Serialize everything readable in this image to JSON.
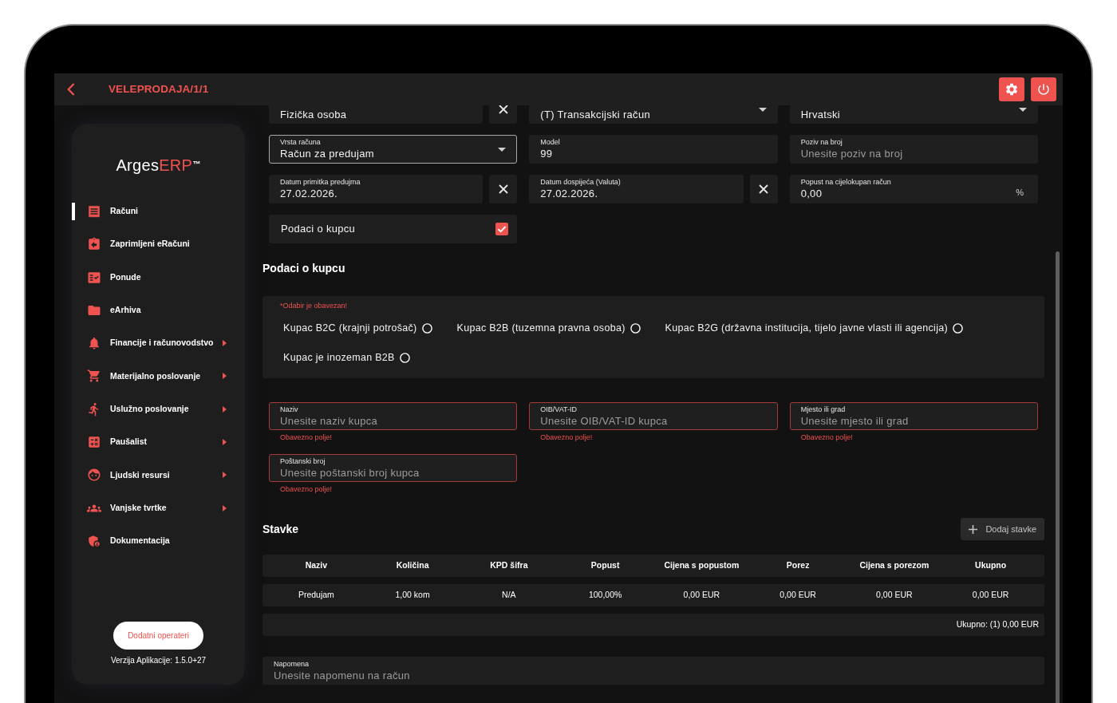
{
  "header": {
    "title": "VELEPRODAJA/1/1"
  },
  "sidebar": {
    "logo": {
      "name": "Arges",
      "accent": "ERP",
      "trademark": "™"
    },
    "items": [
      {
        "label": "Računi",
        "selected": true,
        "submenu": false
      },
      {
        "label": "Zaprimljeni eRačuni",
        "selected": false,
        "submenu": false
      },
      {
        "label": "Ponude",
        "selected": false,
        "submenu": false
      },
      {
        "label": "eArhiva",
        "selected": false,
        "submenu": false
      },
      {
        "label": "Financije i računovodstvo",
        "selected": false,
        "submenu": true
      },
      {
        "label": "Materijalno poslovanje",
        "selected": false,
        "submenu": true
      },
      {
        "label": "Uslužno poslovanje",
        "selected": false,
        "submenu": true
      },
      {
        "label": "Paušalist",
        "selected": false,
        "submenu": true
      },
      {
        "label": "Ljudski resursi",
        "selected": false,
        "submenu": true
      },
      {
        "label": "Vanjske tvrtke",
        "selected": false,
        "submenu": true
      },
      {
        "label": "Dokumentacija",
        "selected": false,
        "submenu": false
      }
    ],
    "button": "Dodatni operateri",
    "version": "Verzija Aplikacije: 1.5.0+27"
  },
  "invoice_form": {
    "fields": [
      {
        "kind": "text",
        "value": "Fizička osoba",
        "focused": false,
        "clearable": true
      },
      {
        "kind": "select",
        "value": "(T) Transakcijski račun",
        "focused": false,
        "clearable": false
      },
      {
        "kind": "select",
        "value": "Hrvatski",
        "focused": false,
        "clearable": false
      },
      {
        "kind": "select",
        "label": "Vrsta računa",
        "value": "Račun za predujam",
        "focused": true,
        "clearable": false
      },
      {
        "kind": "text",
        "label": "Model",
        "value": "99",
        "focused": false,
        "clearable": false
      },
      {
        "kind": "text",
        "label": "Poziv na broj",
        "placeholder": "Unesite poziv na broj",
        "focused": false,
        "clearable": false
      },
      {
        "kind": "text",
        "label": "Datum primitka predujma",
        "value": "27.02.2026.",
        "focused": false,
        "clearable": true
      },
      {
        "kind": "text",
        "label": "Datum dospijeća (Valuta)",
        "value": "27.02.2026.",
        "focused": false,
        "clearable": true
      },
      {
        "kind": "text",
        "label": "Popust na cijelokupan račun",
        "value": "0,00",
        "suffix": "%",
        "focused": false,
        "clearable": false
      },
      {
        "kind": "checkbox",
        "label": "Podaci o kupcu",
        "checked": true,
        "focused": false,
        "clearable": false
      }
    ]
  },
  "customer": {
    "title": "Podaci o kupcu",
    "type_choice": {
      "error": "*Odabir je obavezan!",
      "options": [
        {
          "label": "Kupac B2C (krajnji potrošač)",
          "selected": false
        },
        {
          "label": "Kupac B2B (tuzemna pravna osoba)",
          "selected": false
        },
        {
          "label": "Kupac B2G (državna institucija, tijelo javne vlasti ili agencija)",
          "selected": false
        },
        {
          "label": "Kupac je inozeman B2B",
          "selected": false
        }
      ]
    },
    "fields": [
      {
        "label": "Naziv",
        "placeholder": "Unesite naziv kupca",
        "invalid": true,
        "error": "Obavezno polje!"
      },
      {
        "label": "OIB/VAT-ID",
        "placeholder": "Unesite OIB/VAT-ID kupca",
        "invalid": true,
        "error": "Obavezno polje!"
      },
      {
        "label": "Mjesto ili grad",
        "placeholder": "Unesite mjesto ili grad",
        "invalid": true,
        "error": "Obavezno polje!"
      },
      {
        "label": "Poštanski broj",
        "placeholder": "Unesite poštanski broj kupca",
        "invalid": true,
        "error": "Obavezno polje!"
      }
    ]
  },
  "items": {
    "title": "Stavke",
    "add_button": "Dodaj stavke",
    "columns": [
      "Naziv",
      "Količina",
      "KPD šifra",
      "Popust",
      "Cijena s popustom",
      "Porez",
      "Cijena s porezom",
      "Ukupno"
    ],
    "rows": [
      [
        "Predujam",
        "1,00 kom",
        "N/A",
        "100,00%",
        "0,00 EUR",
        "0,00 EUR",
        "0,00 EUR",
        "0,00 EUR"
      ]
    ],
    "total": "Ukupno: (1) 0,00 EUR"
  },
  "note": {
    "label": "Napomena",
    "placeholder": "Unesite napomenu na račun"
  }
}
